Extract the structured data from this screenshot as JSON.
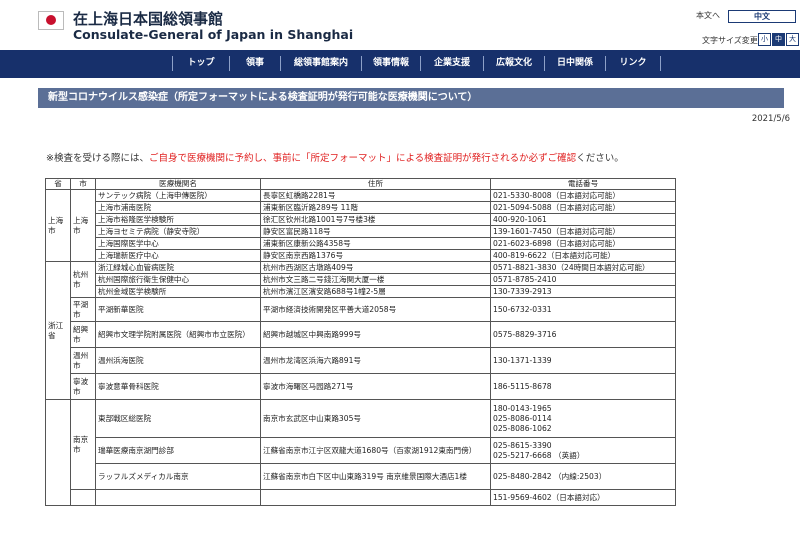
{
  "header": {
    "title_jp": "在上海日本国総領事館",
    "title_en": "Consulate-General of Japan in Shanghai",
    "lang_ja": "本文へ",
    "lang_zh": "中文",
    "font_size_label": "文字サイズ変更",
    "font_sizes": [
      "小",
      "中",
      "大"
    ]
  },
  "nav": [
    "トップ",
    "領事",
    "総領事館案内",
    "領事情報",
    "企業支援",
    "広報文化",
    "日中関係",
    "リンク"
  ],
  "page": {
    "banner": "新型コロナウイルス感染症（所定フォーマットによる検査証明が発行可能な医療機関について）",
    "date": "2021/5/6",
    "notice_pre": "※検査を受ける際には、",
    "notice_red": "ご自身で医療機関に予約し、事前に「所定フォーマット」による検査証明が発行されるか必ずご確認",
    "notice_post": "ください。"
  },
  "table": {
    "headers": [
      "省",
      "市",
      "医療機関名",
      "住所",
      "電話番号"
    ],
    "shanghai": {
      "province": "上海市",
      "city": "上海市",
      "rows": [
        [
          "サンテック病院（上海申傳医院）",
          "長寧区虹橋路2281号",
          "021-5330-8008（日本語対応可能）"
        ],
        [
          "上海市浦南医院",
          "浦東新区臨沂路289号 11階",
          "021-5094-5088（日本語対応可能）"
        ],
        [
          "上海市裕隆医学検験所",
          "徐汇区钦州北路1001号7号楼3楼",
          "400-920-1061"
        ],
        [
          "上海ヨセミテ病院（静安寺院）",
          "静安区富民路118号",
          "139-1601-7450（日本語対応可能）"
        ],
        [
          "上海国際医学中心",
          "浦東新区康新公路4358号",
          "021-6023-6898（日本語対応可能）"
        ],
        [
          "上海瑞新医疗中心",
          "静安区南京西路1376号",
          "400-819-6622（日本語対応可能）"
        ]
      ]
    },
    "zhejiang": {
      "province": "浙江省",
      "hangzhou": "杭州市",
      "hangzhou_rows": [
        [
          "浙江緑城心血管病医院",
          "杭州市西湖区古墩路409号",
          "0571-8821-3830（24時間日本語対応可能）"
        ],
        [
          "杭州国際旅行衛生保健中心",
          "杭州市文三路二号錢江海関大厦一楼",
          "0571-8785-2410"
        ],
        [
          "杭州金域医学検験所",
          "杭州市濱江区濱安路688号1幢2-5層",
          "130-7339-2913"
        ]
      ],
      "pinghu": "平湖市",
      "pinghu_row": [
        "平湖新華医院",
        "平湖市経済技術開発区平善大道2058号",
        "150-6732-0331"
      ],
      "shaoxing": "紹興市",
      "shaoxing_row": [
        "紹興市文理学院附属医院（紹興市市立医院）",
        "紹興市越城区中興南路999号",
        "0575-8829-3716"
      ],
      "wenzhou": "温州市",
      "wenzhou_row": [
        "温州浜海医院",
        "温州市龙湾区浜海六路891号",
        "130-1371-1339"
      ],
      "ningbo": "寧波市",
      "ningbo_row": [
        "寧波意華骨科医院",
        "寧波市海曙区马园路271号",
        "186-5115-8678"
      ]
    },
    "jiangsu": {
      "nanjing": "南京市",
      "row1": [
        "東部戦区総医院",
        "南京市玄武区中山東路305号",
        [
          "180-0143-1965",
          "025-8086-0114",
          "025-8086-1062"
        ]
      ],
      "row2": [
        "瑞華医療南京湖門診部",
        "江蘇省南京市江宁区双龍大道1680号（百家湖1912東南門傍）",
        [
          "025-8615-3390",
          "025-5217-6668 （英語）"
        ]
      ],
      "row3": [
        "ラッフルズメディカル南京",
        "江蘇省南京市白下区中山東路319号 南京維景国際大酒店1楼",
        [
          "025-8480-2842 （内線:2503）"
        ]
      ],
      "row4": [
        "",
        "",
        [
          "151-9569-4602（日本語対応）"
        ]
      ]
    }
  }
}
